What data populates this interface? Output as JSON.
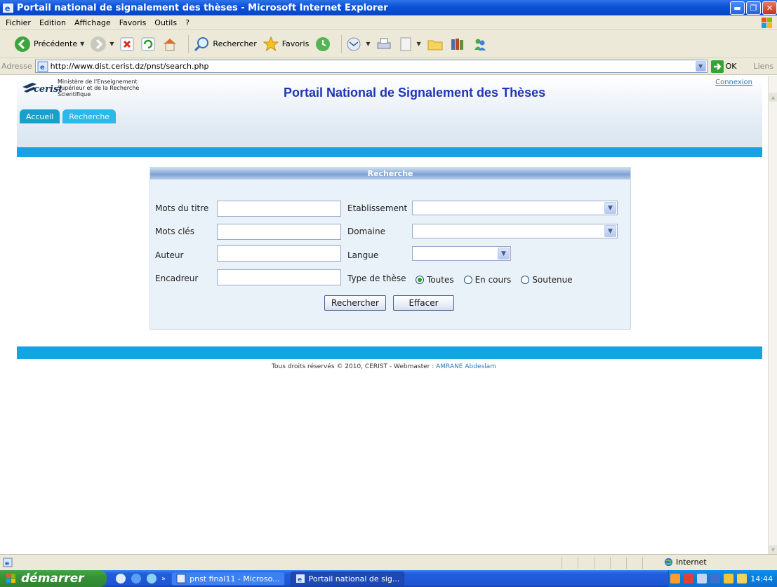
{
  "window": {
    "title": "Portail national de signalement des thèses - Microsoft Internet Explorer",
    "minimize_icon": "minimize-icon",
    "maximize_icon": "maximize-icon",
    "close_icon": "close-icon"
  },
  "menu": [
    "Fichier",
    "Edition",
    "Affichage",
    "Favoris",
    "Outils",
    "?"
  ],
  "toolbar": {
    "back_label": "Précédente",
    "search_label": "Rechercher",
    "favorites_label": "Favoris"
  },
  "address": {
    "label": "Adresse",
    "url": "http://www.dist.cerist.dz/pnst/search.php",
    "go_label": "OK",
    "links_label": "Liens"
  },
  "site": {
    "logo_text": "cerist",
    "ministry_lines": [
      "Ministère de l'Enseignement",
      "Supérieur et de la Recherche",
      "Scientifique"
    ],
    "title": "Portail National de Signalement des Thèses",
    "connexion": "Connexion",
    "tabs": [
      "Accueil",
      "Recherche"
    ]
  },
  "search": {
    "panel_title": "Recherche",
    "fields": {
      "titre": {
        "label": "Mots du titre",
        "value": ""
      },
      "motscles": {
        "label": "Mots clés",
        "value": ""
      },
      "auteur": {
        "label": "Auteur",
        "value": ""
      },
      "encadreur": {
        "label": "Encadreur",
        "value": ""
      },
      "etablissement": {
        "label": "Etablissement",
        "value": ""
      },
      "domaine": {
        "label": "Domaine",
        "value": ""
      },
      "langue": {
        "label": "Langue",
        "value": ""
      }
    },
    "type_label": "Type de thèse",
    "type_options": [
      "Toutes",
      "En cours",
      "Soutenue"
    ],
    "type_selected": "Toutes",
    "submit_label": "Rechercher",
    "reset_label": "Effacer"
  },
  "footer": {
    "text": "Tous droits réservés © 2010, CERIST - Webmaster : ",
    "webmaster": "AMRANE Abdeslam"
  },
  "status": {
    "zone": "Internet"
  },
  "taskbar": {
    "start_label": "démarrer",
    "tasks": [
      "pnst final11 - Microso...",
      "Portail national de sig..."
    ],
    "clock": "14:44",
    "overflow": "»"
  },
  "colors": {
    "accent_blue": "#16a3e3",
    "title_blue": "#1f35b8",
    "link_blue": "#2a7ab8"
  }
}
